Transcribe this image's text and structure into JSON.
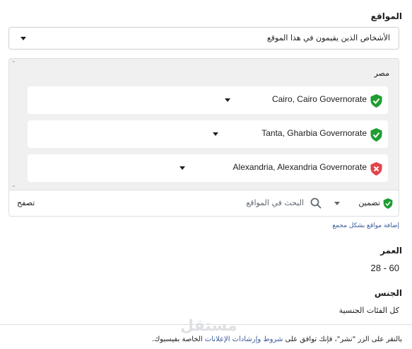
{
  "locations": {
    "label": "المواقع",
    "audience_option": "الأشخاص الذين يقيمون في هذا الموقع",
    "country": "مصر",
    "items": [
      {
        "name": "Cairo, Cairo Governorate",
        "status": "included"
      },
      {
        "name": "Tanta, Gharbia Governorate",
        "status": "included"
      },
      {
        "name": "Alexandria, Alexandria Governorate",
        "status": "excluded"
      }
    ],
    "include_label": "تضمين",
    "search_placeholder": "البحث في المواقع",
    "browse_label": "تصفح",
    "bulk_link": "إضافة مواقع بشكل مجمع"
  },
  "age": {
    "label": "العمر",
    "value": "28 - 60"
  },
  "gender": {
    "label": "الجنس",
    "value": "كل الفئات الجنسية"
  },
  "terms": {
    "prefix": "بالنقر على الزر \"نشر\"، فإنك توافق على",
    "link_text": "شروط وإرشادات الإعلانات",
    "suffix": "الخاصة بفيسبوك."
  },
  "watermark": "مستقل",
  "colors": {
    "included": "#1f9d31",
    "excluded": "#e4434b",
    "link": "#385898"
  }
}
